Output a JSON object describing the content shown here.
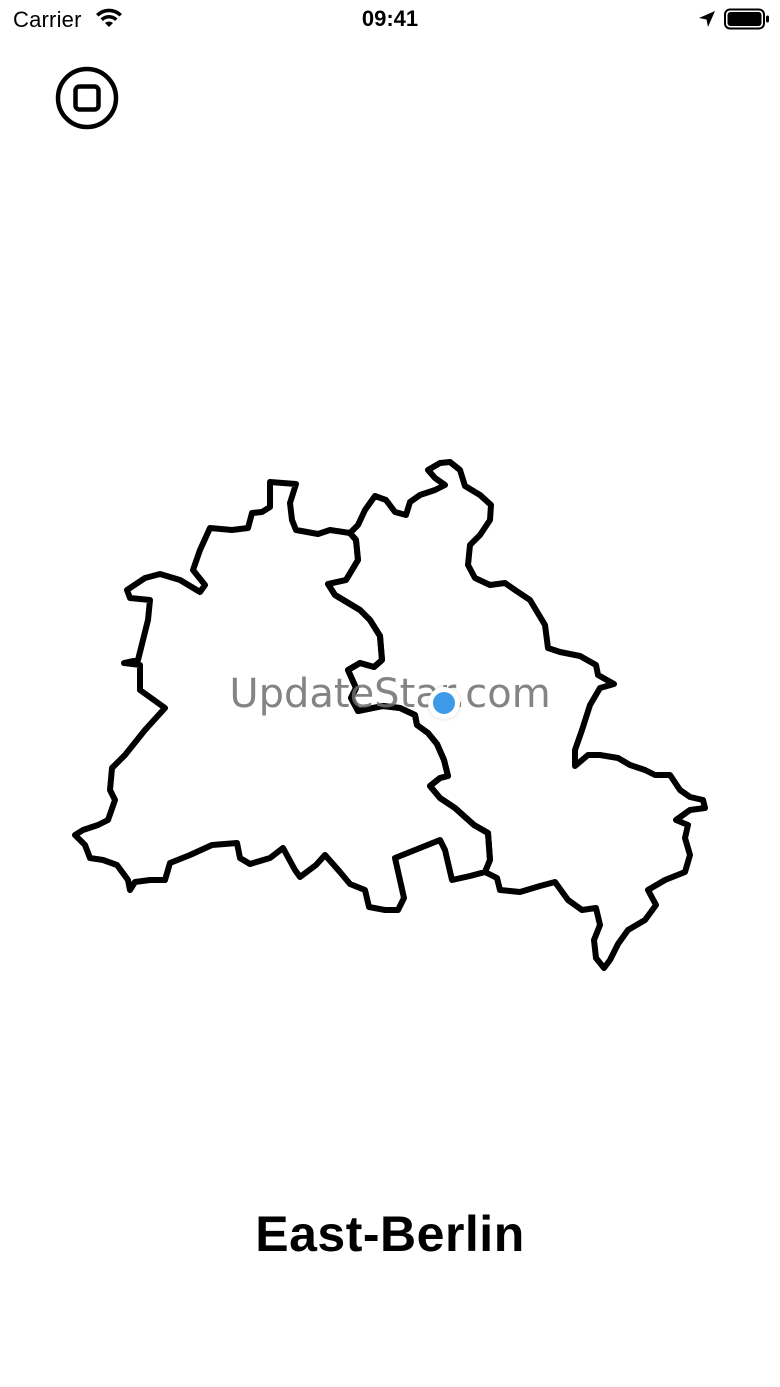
{
  "status_bar": {
    "carrier": "Carrier",
    "time": "09:41",
    "icons": [
      "wifi-icon",
      "location-arrow-icon",
      "battery-icon"
    ]
  },
  "toolbar": {
    "stop_button_icon": "stop-square-in-circle-icon"
  },
  "map": {
    "regions": [
      "west-berlin-outline",
      "east-berlin-outline"
    ],
    "outline_color": "#000000",
    "user_location_color": "#3d9ae8"
  },
  "watermark": {
    "text": "UpdateStar.com"
  },
  "answer": {
    "label": "East-Berlin"
  }
}
